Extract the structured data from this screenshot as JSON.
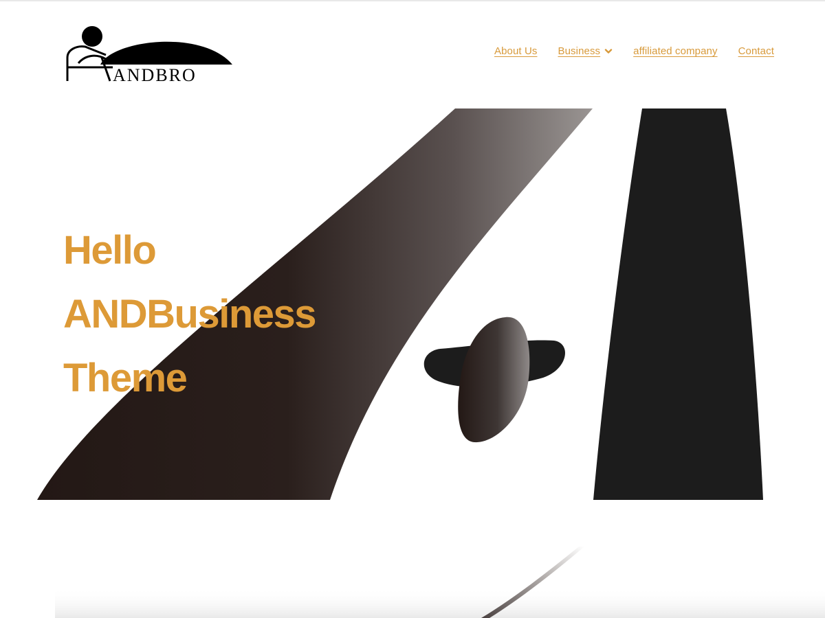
{
  "site": {
    "logo_text": "ANDBRO"
  },
  "nav": {
    "items": [
      {
        "label": "About Us"
      },
      {
        "label": "Business",
        "has_dropdown": true
      },
      {
        "label": "affiliated company"
      },
      {
        "label": "Contact"
      }
    ]
  },
  "hero": {
    "title_lines": [
      "Hello",
      "ANDBusiness",
      "Theme"
    ]
  },
  "colors": {
    "accent": "#dd9a37",
    "nav_link": "#d89a3b",
    "dark": "#1c1c1c",
    "background": "#ffffff"
  },
  "icons": {
    "dropdown": "chevron-down-icon"
  }
}
